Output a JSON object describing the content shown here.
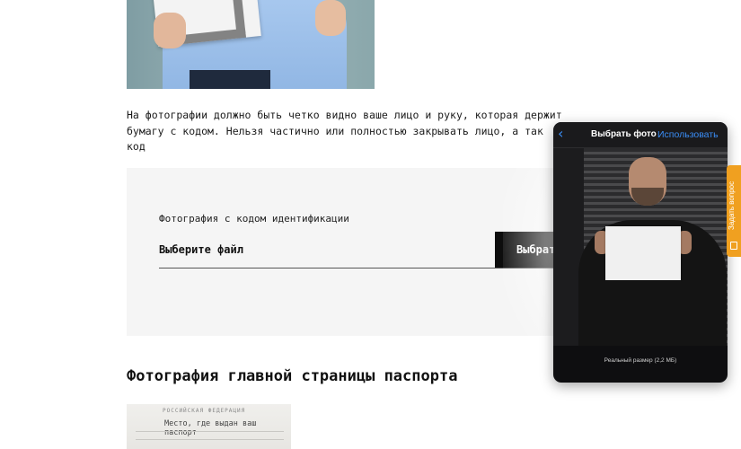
{
  "content": {
    "paragraph": "На фотографии должно быть четко видно ваше лицо и руку, которая держит\nбумагу с кодом. Нельзя частично или полностью закрывать лицо, а так\nкод",
    "upload": {
      "label": "Фотография с кодом идентификации",
      "file_text": "Выберите файл",
      "button_label": "Выбрать"
    },
    "section_title": "Фотография главной страницы паспорта",
    "passport_preview": {
      "header": "РОССИЙСКАЯ ФЕДЕРАЦИЯ",
      "text": "Место, где выдан ваш паспорт"
    }
  },
  "photo_picker": {
    "back_icon": "chevron-left-icon",
    "title": "Выбрать фото",
    "use_label": "Использовать",
    "caption": "Реальный размер (2,2 МБ)"
  },
  "side_tab": {
    "label": "Задать вопрос",
    "icon": "chat-icon",
    "color": "#f0a020"
  },
  "colors": {
    "accent_blue": "#3a8df5",
    "button_black": "#0d0d0d",
    "box_bg": "#f5f5f5"
  }
}
